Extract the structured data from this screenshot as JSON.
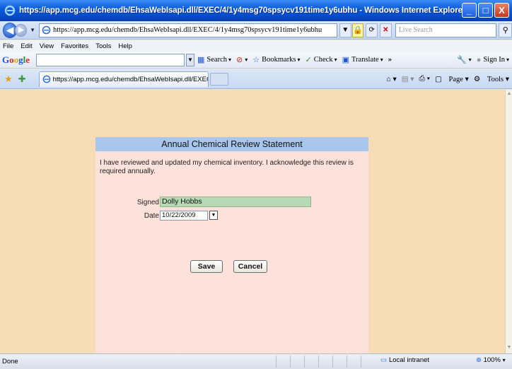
{
  "window": {
    "title": "https://app.mcg.edu/chemdb/EhsaWebIsapi.dll/EXEC/4/1y4msg70spsycv191time1y6ubhu - Windows Internet Explorer",
    "minimize": "_",
    "maximize": "□",
    "close": "X"
  },
  "address_bar": {
    "url": "https://app.mcg.edu/chemdb/EhsaWebIsapi.dll/EXEC/4/1y4msg70spsycv191time1y6ubhu",
    "search_placeholder": "Live Search"
  },
  "menu": [
    "File",
    "Edit",
    "View",
    "Favorites",
    "Tools",
    "Help"
  ],
  "google_toolbar": {
    "logo": [
      "G",
      "o",
      "o",
      "g",
      "l",
      "e"
    ],
    "search_label": "Search",
    "bookmarks_label": "Bookmarks",
    "check_label": "Check",
    "translate_label": "Translate",
    "more_label": "»",
    "signin_label": "Sign In"
  },
  "tab_bar": {
    "tab_title": "https://app.mcg.edu/chemdb/EhsaWebIsapi.dll/EXEC...",
    "page_label": "Page",
    "tools_label": "Tools"
  },
  "form": {
    "heading": "Annual Chemical Review Statement",
    "statement": "I have reviewed and updated my chemical inventory. I acknowledge this review is required annually.",
    "signed_label": "Signed",
    "signed_value": "Dolly Hobbs",
    "date_label": "Date",
    "date_value": "10/22/2009",
    "save_label": "Save",
    "cancel_label": "Cancel"
  },
  "status_bar": {
    "status": "Done",
    "zone": "Local intranet",
    "zoom": "100%"
  },
  "colors": {
    "page_bg": "#f7dcb5",
    "panel_bg": "#fde1db",
    "header_bg": "#a9c7ec",
    "signed_field_bg": "#b7d9b5"
  }
}
